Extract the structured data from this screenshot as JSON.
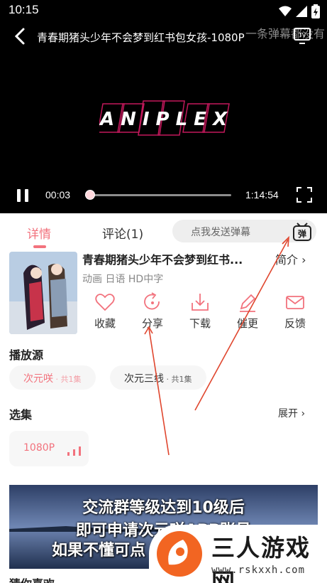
{
  "status_bar": {
    "time": "10:15"
  },
  "player": {
    "title": "青春期猪头少年不会梦到红书包女孩-1080P",
    "danmu_overlay": "一条弹幕都没有",
    "logo_text": "ANIPLEX",
    "current_time": "00:03",
    "total_time": "1:14:54",
    "progress_fraction": 0.01
  },
  "tabs": [
    {
      "label": "详情",
      "active": true
    },
    {
      "label": "评论(1)",
      "active": false
    }
  ],
  "danmu_input": {
    "placeholder": "点我发送弹幕",
    "button_label": "弹"
  },
  "info": {
    "title": "青春期猪头少年不会梦到红书...",
    "intro_link": "简介",
    "meta": "动画 日语 HD中字",
    "actions": [
      {
        "icon": "heart-icon",
        "label": "收藏"
      },
      {
        "icon": "share-icon",
        "label": "分享"
      },
      {
        "icon": "download-icon",
        "label": "下载"
      },
      {
        "icon": "urge-update-icon",
        "label": "催更"
      },
      {
        "icon": "feedback-icon",
        "label": "反馈"
      }
    ]
  },
  "sources": {
    "title": "播放源",
    "items": [
      {
        "name": "次元咲",
        "sub": " · 共1集",
        "active": true
      },
      {
        "name": "次元三线",
        "sub": " · 共1集",
        "active": false
      }
    ]
  },
  "episodes": {
    "title": "选集",
    "expand": "展开",
    "items": [
      {
        "label": "1080P"
      }
    ]
  },
  "banner": {
    "lines": [
      "交流群等级达到10级后",
      "即可申请次元咲APP账号",
      "如果不懂可点"
    ]
  },
  "guess": {
    "title": "猜你喜欢"
  },
  "watermark": {
    "name": "三人游戏网",
    "url": "www.rskxxh.com"
  },
  "colors": {
    "accent": "#f2727d",
    "annotation": "#e0462e"
  }
}
